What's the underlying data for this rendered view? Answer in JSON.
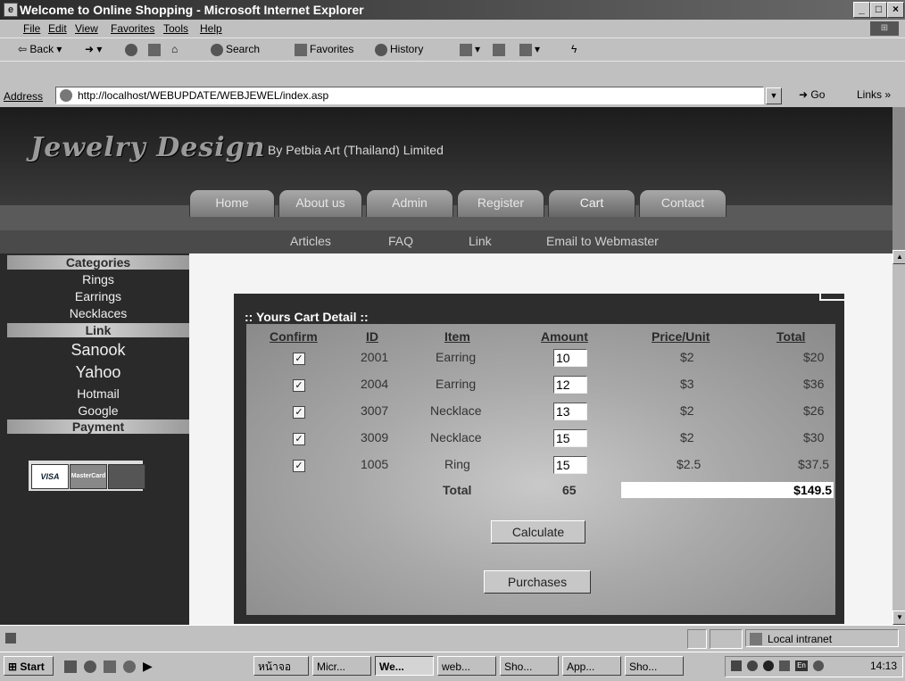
{
  "window": {
    "title": "Welcome to Online Shopping - Microsoft Internet Explorer"
  },
  "menu": [
    "File",
    "Edit",
    "View",
    "Favorites",
    "Tools",
    "Help"
  ],
  "toolbar": {
    "back": "Back",
    "search": "Search",
    "favorites": "Favorites",
    "history": "History"
  },
  "address": {
    "label": "Address",
    "url": "http://localhost/WEBUPDATE/WEBJEWEL/index.asp",
    "go": "Go",
    "links": "Links »"
  },
  "site": {
    "logo": "Jewelry Design",
    "byline": "By Petbia Art (Thailand) Limited",
    "tabs": [
      "Home",
      "About us",
      "Admin",
      "Register",
      "Cart",
      "Contact"
    ],
    "active_tab": "Cart",
    "subnav": [
      "Articles",
      "FAQ",
      "Link",
      "Email to Webmaster"
    ]
  },
  "sidebar": {
    "categories_title": "Categories",
    "categories": [
      "Rings",
      "Earrings",
      "Necklaces"
    ],
    "link_title": "Link",
    "links": [
      "Sanook",
      "Yahoo",
      "Hotmail",
      "Google"
    ],
    "payment_title": "Payment",
    "cards": [
      "VISA",
      "MasterCard",
      ""
    ]
  },
  "cart": {
    "title": ":: Yours Cart Detail ::",
    "headers": [
      "Confirm",
      "ID",
      "Item",
      "Amount",
      "Price/Unit",
      "Total"
    ],
    "rows": [
      {
        "confirm": true,
        "id": "2001",
        "item": "Earring",
        "amount": "10",
        "price": "$2",
        "total": "$20"
      },
      {
        "confirm": true,
        "id": "2004",
        "item": "Earring",
        "amount": "12",
        "price": "$3",
        "total": "$36"
      },
      {
        "confirm": true,
        "id": "3007",
        "item": "Necklace",
        "amount": "13",
        "price": "$2",
        "total": "$26"
      },
      {
        "confirm": true,
        "id": "3009",
        "item": "Necklace",
        "amount": "15",
        "price": "$2",
        "total": "$30"
      },
      {
        "confirm": true,
        "id": "1005",
        "item": "Ring",
        "amount": "15",
        "price": "$2.5",
        "total": "$37.5"
      }
    ],
    "total_label": "Total",
    "total_amount": "65",
    "grand_total": "$149.5",
    "calculate": "Calculate",
    "purchases": "Purchases"
  },
  "status": {
    "zone": "Local intranet"
  },
  "taskbar": {
    "start": "Start",
    "buttons": [
      "หน้าจอ",
      "Micr...",
      "We...",
      "web...",
      "Sho...",
      "App...",
      "Sho..."
    ],
    "active_index": 2,
    "clock": "14:13"
  }
}
